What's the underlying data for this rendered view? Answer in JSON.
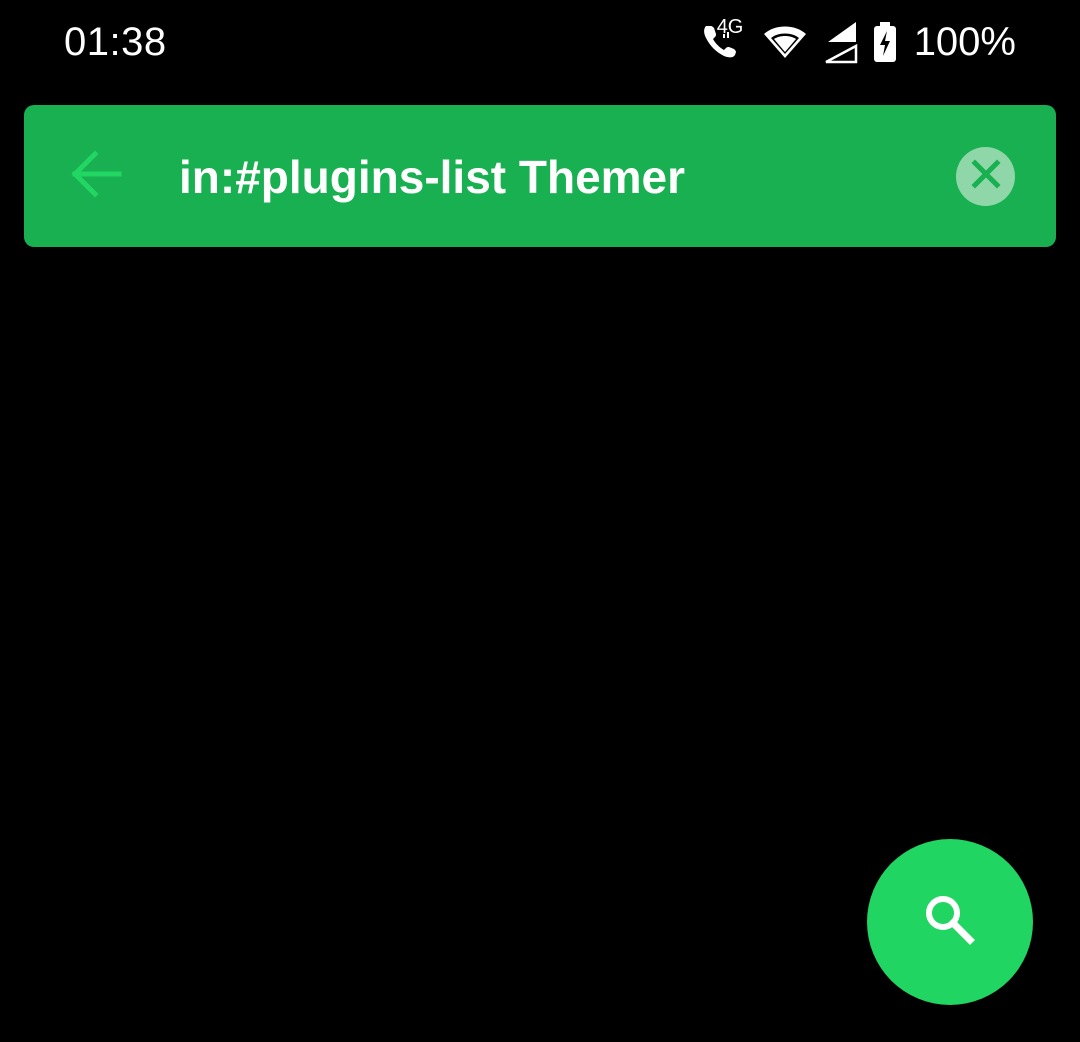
{
  "status_bar": {
    "time": "01:38",
    "network_label": "4G",
    "battery_text": "100%",
    "icons": [
      "phone-volte-icon",
      "wifi-icon",
      "cell-signal-icon",
      "battery-charging-icon"
    ]
  },
  "search": {
    "query": "in:#plugins-list Themer",
    "back_icon": "arrow-left-icon",
    "clear_icon": "close-circle-icon"
  },
  "fab": {
    "icon": "search-icon"
  },
  "colors": {
    "background": "#000000",
    "search_bar": "#18b050",
    "back_arrow": "#22d664",
    "clear_button_bg": "#8fd7a8",
    "clear_x": "#18b050",
    "fab": "#20d561"
  }
}
